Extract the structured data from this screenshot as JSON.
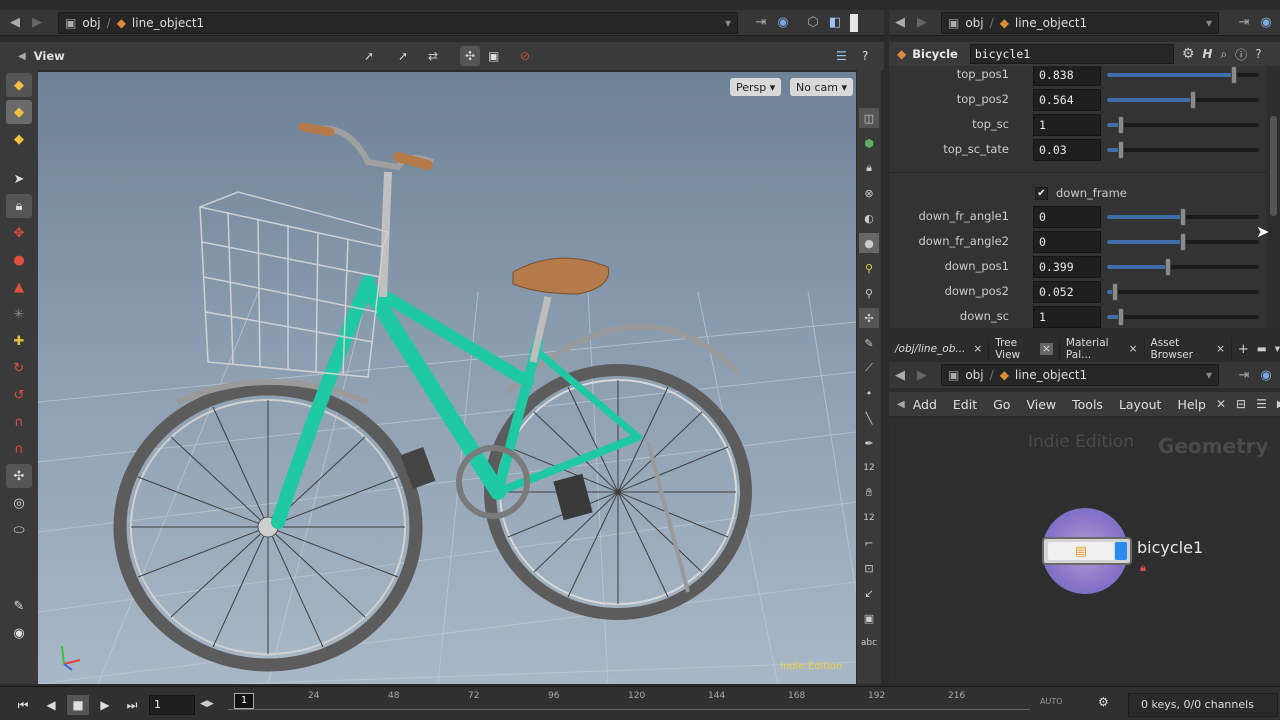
{
  "viewer_path": {
    "root": "obj",
    "node": "line_object1"
  },
  "param_path": {
    "root": "obj",
    "node": "line_object1"
  },
  "view_toolbar": {
    "title": "View"
  },
  "viewport": {
    "persp_label": "Persp",
    "cam_label": "No cam",
    "watermark": "Indie Edition"
  },
  "param_header": {
    "type_label": "Bicycle",
    "node_name": "bicycle1"
  },
  "params": [
    {
      "label": "top_pos1",
      "value": "0.838",
      "slider": 0.838
    },
    {
      "label": "top_pos2",
      "value": "0.564",
      "slider": 0.564
    },
    {
      "label": "top_sc",
      "value": "1",
      "slider": 0.09
    },
    {
      "label": "top_sc_tate",
      "value": "0.03",
      "slider": 0.09
    },
    {
      "label": "down_fr_angle1",
      "value": "0",
      "slider": 0.5
    },
    {
      "label": "down_fr_angle2",
      "value": "0",
      "slider": 0.5
    },
    {
      "label": "down_pos1",
      "value": "0.399",
      "slider": 0.399
    },
    {
      "label": "down_pos2",
      "value": "0.052",
      "slider": 0.052
    },
    {
      "label": "down_sc",
      "value": "1",
      "slider": 0.09
    }
  ],
  "down_frame_toggle": {
    "label": "down_frame",
    "checked": true
  },
  "tabs": [
    {
      "label": "/obj/line_ob..."
    },
    {
      "label": "Tree View"
    },
    {
      "label": "Material Pal..."
    },
    {
      "label": "Asset Browser"
    }
  ],
  "network_path": {
    "root": "obj",
    "node": "line_object1"
  },
  "network_menu": [
    "Add",
    "Edit",
    "Go",
    "View",
    "Tools",
    "Layout",
    "Help"
  ],
  "network": {
    "edition_label": "Indie Edition",
    "context_label": "Geometry",
    "node_label": "bicycle1"
  },
  "timeline": {
    "current_frame": "1",
    "frame_field": "1",
    "ticks": [
      "24",
      "48",
      "72",
      "96",
      "120",
      "144",
      "168",
      "192",
      "216"
    ],
    "keys_status": "0 keys, 0/0 channels",
    "auto_label": "AUTO"
  },
  "colors": {
    "accent_blue": "#3d6ea8",
    "bike_frame": "#1fc9a4",
    "saddle": "#b57a4a"
  }
}
